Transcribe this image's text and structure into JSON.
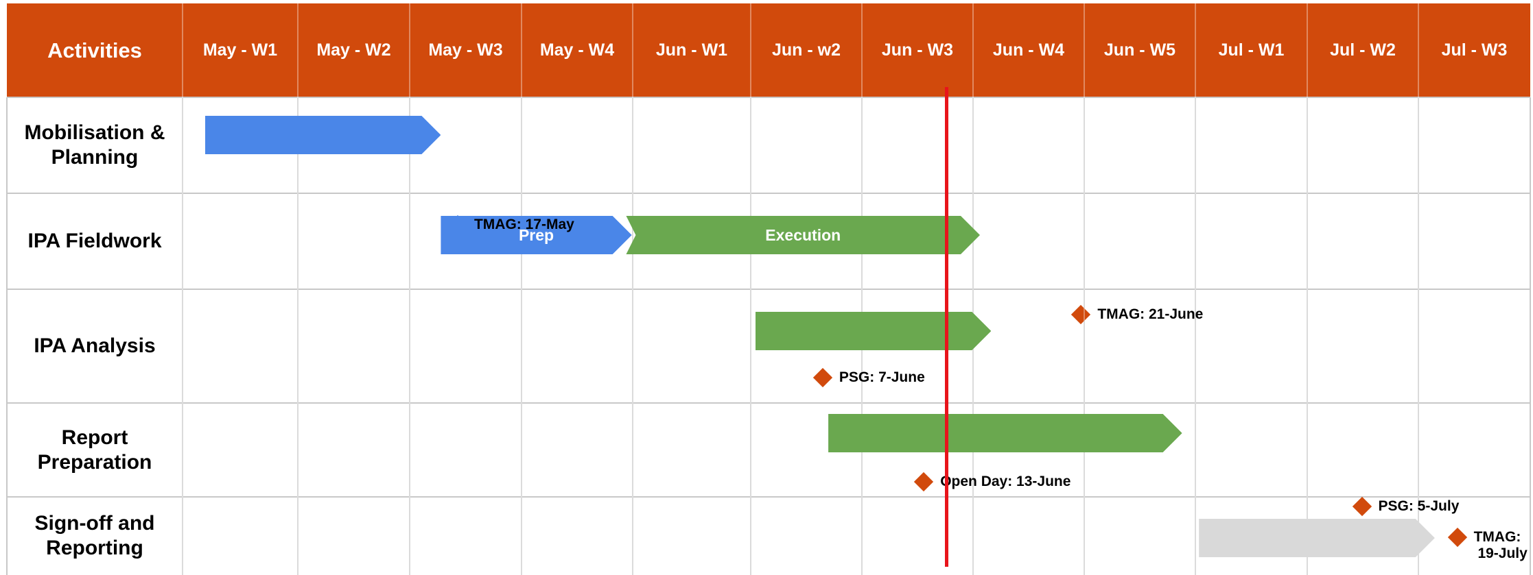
{
  "header": {
    "activities_label": "Activities",
    "weeks": [
      "May - W1",
      "May - W2",
      "May - W3",
      "May - W4",
      "Jun - W1",
      "Jun - w2",
      "Jun - W3",
      "Jun - W4",
      "Jun - W5",
      "Jul - W1",
      "Jul - W2",
      "Jul - W3"
    ]
  },
  "activities": [
    {
      "label": "Mobilisation & Planning",
      "bars": [
        {
          "start": 0.2,
          "end": 2.3,
          "color": "blue",
          "label": ""
        }
      ],
      "milestones": []
    },
    {
      "label": "IPA Fieldwork",
      "bars": [
        {
          "start": 2.3,
          "end": 4.0,
          "color": "blue",
          "label": "Prep"
        },
        {
          "start": 3.95,
          "end": 7.1,
          "color": "green",
          "label": "Execution"
        }
      ],
      "milestones": [
        {
          "pos": 2.45,
          "offset": 0.33,
          "color": "blue",
          "label": "TMAG: 17-May"
        }
      ]
    },
    {
      "label": "IPA Analysis",
      "bars": [
        {
          "start": 5.1,
          "end": 7.2,
          "color": "green",
          "label": ""
        }
      ],
      "milestones": [
        {
          "pos": 5.7,
          "offset": 0.78,
          "color": "orange",
          "label": "PSG: 7-June"
        },
        {
          "pos": 8.0,
          "offset": 0.22,
          "color": "orange",
          "label": "TMAG: 21-June"
        }
      ]
    },
    {
      "label": "Report Preparation",
      "bars": [
        {
          "start": 5.75,
          "end": 8.9,
          "color": "green",
          "label": ""
        }
      ],
      "milestones": [
        {
          "pos": 6.6,
          "offset": 0.84,
          "color": "orange",
          "label": "Open Day: 13-June"
        }
      ]
    },
    {
      "label": "Sign-off and Reporting",
      "bars": [
        {
          "start": 9.05,
          "end": 11.15,
          "color": "gray",
          "label": ""
        }
      ],
      "milestones": [
        {
          "pos": 10.5,
          "offset": 0.12,
          "color": "orange",
          "label": "PSG: 5-July"
        },
        {
          "pos": 11.35,
          "offset": 0.52,
          "color": "orange",
          "label": "TMAG: 19-July"
        }
      ]
    }
  ],
  "today_marker": {
    "week_pos": 6.8,
    "color": "#E8141B"
  },
  "colors": {
    "header": "#D14A0C",
    "blue": "#4A86E8",
    "green": "#6AA84F",
    "gray": "#D9D9D9",
    "orange": "#D14A0C",
    "grid": "#C8C8C8"
  }
}
